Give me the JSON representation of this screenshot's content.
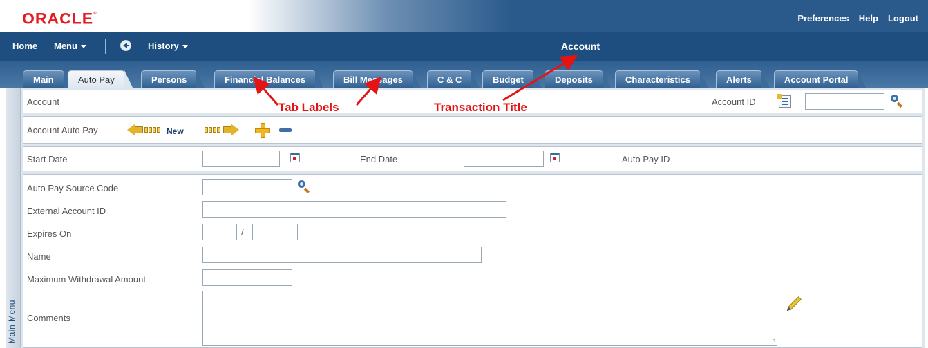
{
  "brand": {
    "logo_text": "ORACLE",
    "accent_color": "#e31b23"
  },
  "top_links": [
    "Preferences",
    "Help",
    "Logout"
  ],
  "nav": {
    "home": "Home",
    "menu": "Menu",
    "history": "History",
    "transaction_title": "Account"
  },
  "tabs": [
    {
      "label": "Main",
      "active": false
    },
    {
      "label": "Auto Pay",
      "active": true
    },
    {
      "label": "Persons",
      "active": false
    },
    {
      "label": "Financial Balances",
      "active": false
    },
    {
      "label": "Bill Messages",
      "active": false
    },
    {
      "label": "C & C",
      "active": false
    },
    {
      "label": "Budget",
      "active": false
    },
    {
      "label": "Deposits",
      "active": false
    },
    {
      "label": "Characteristics",
      "active": false
    },
    {
      "label": "Alerts",
      "active": false
    },
    {
      "label": "Account Portal",
      "active": false
    }
  ],
  "side_menu_label": "Main Menu",
  "account_bar": {
    "label": "Account",
    "account_id_label": "Account ID",
    "account_id_value": ""
  },
  "autopay_bar": {
    "label": "Account Auto Pay",
    "new_label": "New"
  },
  "dates_bar": {
    "start_date_label": "Start Date",
    "end_date_label": "End Date",
    "auto_pay_id_label": "Auto Pay ID"
  },
  "form": {
    "source_code_label": "Auto Pay Source Code",
    "external_account_label": "External Account ID",
    "expires_on_label": "Expires On",
    "expires_separator": "/",
    "name_label": "Name",
    "max_withdrawal_label": "Maximum Withdrawal Amount",
    "comments_label": "Comments"
  },
  "annotations": {
    "tab_labels": "Tab Labels",
    "transaction_title": "Transaction Title",
    "color": "#e41414"
  }
}
